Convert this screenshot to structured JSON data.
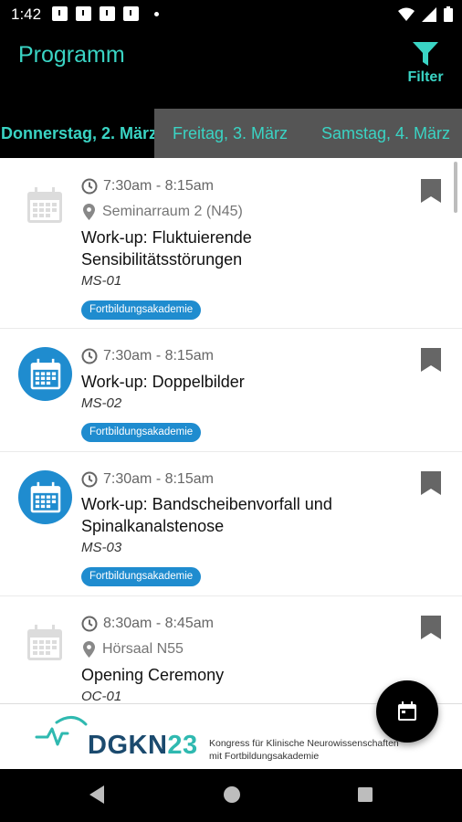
{
  "status_bar": {
    "time": "1:42"
  },
  "app_bar": {
    "title": "Programm",
    "filter_label": "Filter"
  },
  "tabs": [
    {
      "label": "Donnerstag, 2. März",
      "active": true
    },
    {
      "label": "Freitag, 3. März",
      "active": false
    },
    {
      "label": "Samstag, 4. März",
      "active": false
    }
  ],
  "sessions": [
    {
      "time": "7:30am - 8:15am",
      "room": "Seminarraum 2 (N45)",
      "title_line1": "Work-up: Fluktuierende",
      "title_line2": "Sensibilitätsstörungen",
      "code": "MS-01",
      "tag": "Fortbildungsakademie",
      "icon": "calendar-grey"
    },
    {
      "time": "7:30am - 8:15am",
      "room": "",
      "title_line1": "Work-up: Doppelbilder",
      "title_line2": "",
      "code": "MS-02",
      "tag": "Fortbildungsakademie",
      "icon": "calendar-blue"
    },
    {
      "time": "7:30am - 8:15am",
      "room": "",
      "title_line1": "Work-up: Bandscheibenvorfall und",
      "title_line2": "Spinalkanalstenose",
      "code": "MS-03",
      "tag": "Fortbildungsakademie",
      "icon": "calendar-blue"
    },
    {
      "time": "8:30am - 8:45am",
      "room": "Hörsaal N55",
      "title_line1": "Opening Ceremony",
      "title_line2": "",
      "code": "OC-01",
      "tag": "",
      "icon": "calendar-grey"
    }
  ],
  "banner": {
    "brand_text": "DGKN",
    "brand_number": "23",
    "tagline_line1": "Kongress für Klinische Neurowissenschaften",
    "tagline_line2": "mit Fortbildungsakademie"
  },
  "colors": {
    "accent": "#3ad4c4",
    "badge_blue": "#1f8ccf",
    "tab_bg": "#555555",
    "brand_dark": "#1b4a6e"
  }
}
